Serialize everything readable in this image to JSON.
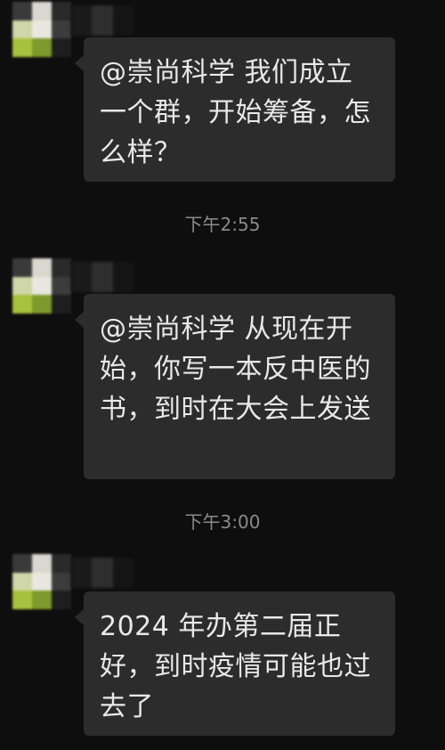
{
  "messages": [
    {
      "text": "@崇尚科学  我们成立一个群，开始筹备，怎么样？"
    },
    {
      "text": "@崇尚科学  从现在开始，你写一本反中医的书，到时在大会上发送"
    },
    {
      "text": "2024 年办第二届正好，到时疫情可能也过去了"
    }
  ],
  "timestamps": [
    "下午2:55",
    "下午3:00"
  ],
  "colors": {
    "background": "#0e0e0e",
    "bubble": "#2c2c2c",
    "text": "#e9e9e9",
    "timestamp": "#8a8a8a",
    "avatar_green": "#9ab83a",
    "avatar_light": "#e8e8e0"
  },
  "icons": [
    "pixelated-avatar-icon"
  ]
}
